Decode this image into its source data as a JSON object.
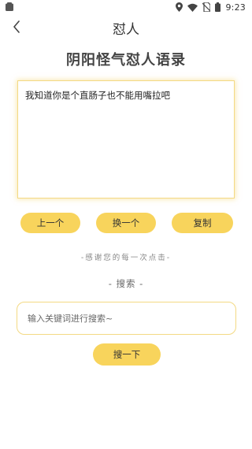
{
  "status_bar": {
    "time": "9:23",
    "icons": [
      "notification-icon",
      "location-icon",
      "wifi-icon",
      "no-sim-icon",
      "battery-icon"
    ]
  },
  "header": {
    "title": "怼人",
    "back_icon": "chevron-left-icon"
  },
  "page_title": "阴阳怪气怼人语录",
  "quote": {
    "text": "我知道你是个直肠子也不能用嘴拉吧"
  },
  "buttons": {
    "prev": "上一个",
    "next": "换一个",
    "copy": "复制"
  },
  "thanks_text": "-感谢您的每一次点击-",
  "search": {
    "label": "- 搜索 -",
    "placeholder": "输入关键词进行搜索~",
    "value": "",
    "button": "搜一下"
  },
  "colors": {
    "accent": "#f8d45c",
    "border": "#f3d983"
  }
}
